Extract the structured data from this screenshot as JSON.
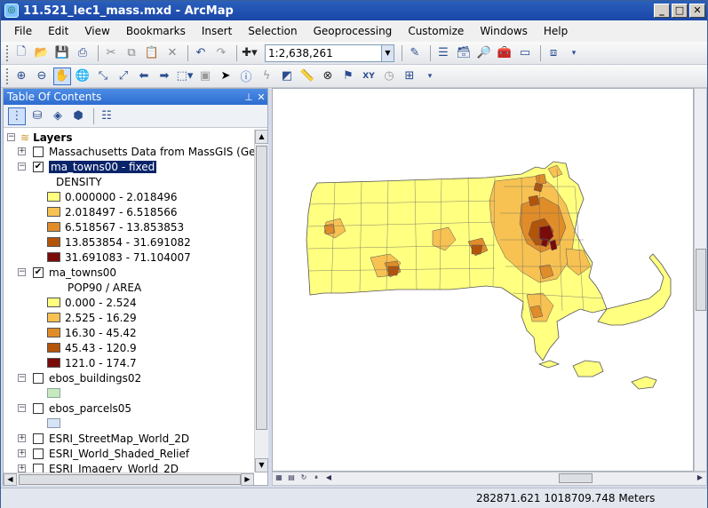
{
  "window": {
    "title": "11.521_lec1_mass.mxd - ArcMap"
  },
  "menu": [
    "File",
    "Edit",
    "View",
    "Bookmarks",
    "Insert",
    "Selection",
    "Geoprocessing",
    "Customize",
    "Windows",
    "Help"
  ],
  "toolbar": {
    "scale": "1:2,638,261"
  },
  "toc": {
    "title": "Table Of Contents",
    "root": "Layers",
    "items": [
      {
        "label": "Massachusetts Data from MassGIS (GeoServer)",
        "checked": false,
        "expanded": false
      },
      {
        "label": "ma_towns00 - fixed",
        "checked": true,
        "expanded": true,
        "selected": true,
        "field": "DENSITY",
        "classes": [
          {
            "label": "0.000000 - 2.018496",
            "color": "#ffff80"
          },
          {
            "label": "2.018497 - 6.518566",
            "color": "#f7c252"
          },
          {
            "label": "6.518567 - 13.853853",
            "color": "#e08d29"
          },
          {
            "label": "13.853854 - 31.691082",
            "color": "#b3540b"
          },
          {
            "label": "31.691083 - 71.104007",
            "color": "#7a0b0b"
          }
        ]
      },
      {
        "label": "ma_towns00",
        "checked": true,
        "expanded": true,
        "field": "POP90 / AREA",
        "classes": [
          {
            "label": "0.000 - 2.524",
            "color": "#ffff80"
          },
          {
            "label": "2.525 - 16.29",
            "color": "#f7c252"
          },
          {
            "label": "16.30 - 45.42",
            "color": "#e08d29"
          },
          {
            "label": "45.43 - 120.9",
            "color": "#b3540b"
          },
          {
            "label": "121.0 - 174.7",
            "color": "#7a0b0b"
          }
        ]
      },
      {
        "label": "ebos_buildings02",
        "checked": false,
        "expanded": true,
        "swatch": "#c8e8c0"
      },
      {
        "label": "ebos_parcels05",
        "checked": false,
        "expanded": true,
        "swatch": "#d6e4f6"
      },
      {
        "label": "ESRI_StreetMap_World_2D",
        "checked": false,
        "expanded": false
      },
      {
        "label": "ESRI_World_Shaded_Relief",
        "checked": false,
        "expanded": false
      },
      {
        "label": "ESRI_Imagery_World_2D",
        "checked": false,
        "expanded": false
      }
    ]
  },
  "status": {
    "coords": "282871.621  1018709.748 Meters"
  }
}
